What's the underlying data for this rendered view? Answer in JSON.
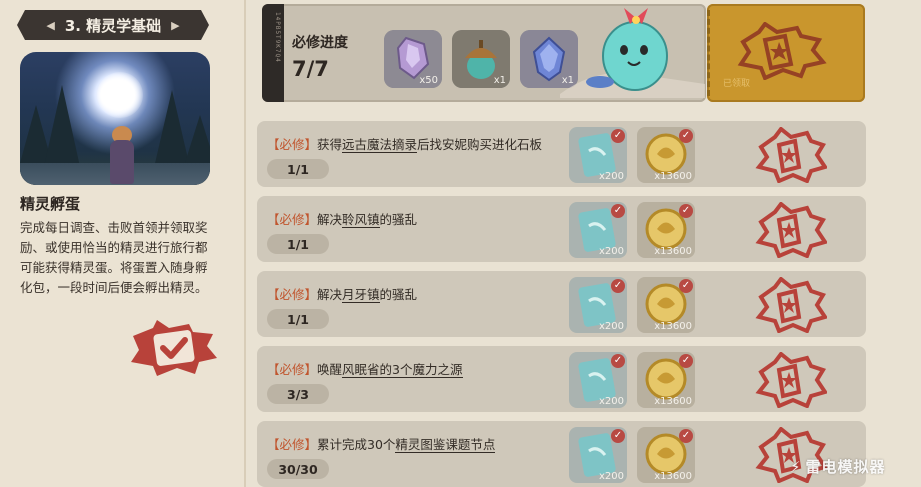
{
  "chapter": {
    "title": "3. 精灵学基础"
  },
  "left": {
    "heading": "精灵孵蛋",
    "description": "完成每日调查、击败首领并领取奖励、或使用恰当的精灵进行旅行都可能获得精灵蛋。将蛋置入随身孵化包，一段时间后便会孵出精灵。"
  },
  "progress": {
    "label": "必修进度",
    "value": "7/7",
    "spine_text": "14PB5T9K7Q4",
    "rewards": [
      {
        "icon": "crystal-icon",
        "count": "x50"
      },
      {
        "icon": "acorn-icon",
        "count": "x1"
      },
      {
        "icon": "gem-icon",
        "count": "x1"
      }
    ],
    "chest_label": "已领取"
  },
  "quests": [
    {
      "tag": "【必修】",
      "title_pre": "获得",
      "title_u": "远古魔法摘录",
      "title_post": "后找安妮购买进化石板",
      "progress": "1/1",
      "item1_count": "x200",
      "item2_count": "x13600"
    },
    {
      "tag": "【必修】",
      "title_pre": "解决",
      "title_u": "聆风镇",
      "title_post": "的骚乱",
      "progress": "1/1",
      "item1_count": "x200",
      "item2_count": "x13600"
    },
    {
      "tag": "【必修】",
      "title_pre": "解决",
      "title_u": "月牙镇",
      "title_post": "的骚乱",
      "progress": "1/1",
      "item1_count": "x200",
      "item2_count": "x13600"
    },
    {
      "tag": "【必修】",
      "title_pre": "唤醒",
      "title_u": "风眠省的3个魔力之源",
      "title_post": "",
      "progress": "3/3",
      "item1_count": "x200",
      "item2_count": "x13600"
    },
    {
      "tag": "【必修】",
      "title_pre": "累计完成30个",
      "title_u": "精灵图鉴课题节点",
      "title_post": "",
      "progress": "30/30",
      "item1_count": "x200",
      "item2_count": "x13600"
    }
  ],
  "watermark": "雷电模拟器",
  "colors": {
    "tag_red": "#c0552e",
    "chest_gold": "#c9962d",
    "stamp_red": "#b8423a"
  }
}
